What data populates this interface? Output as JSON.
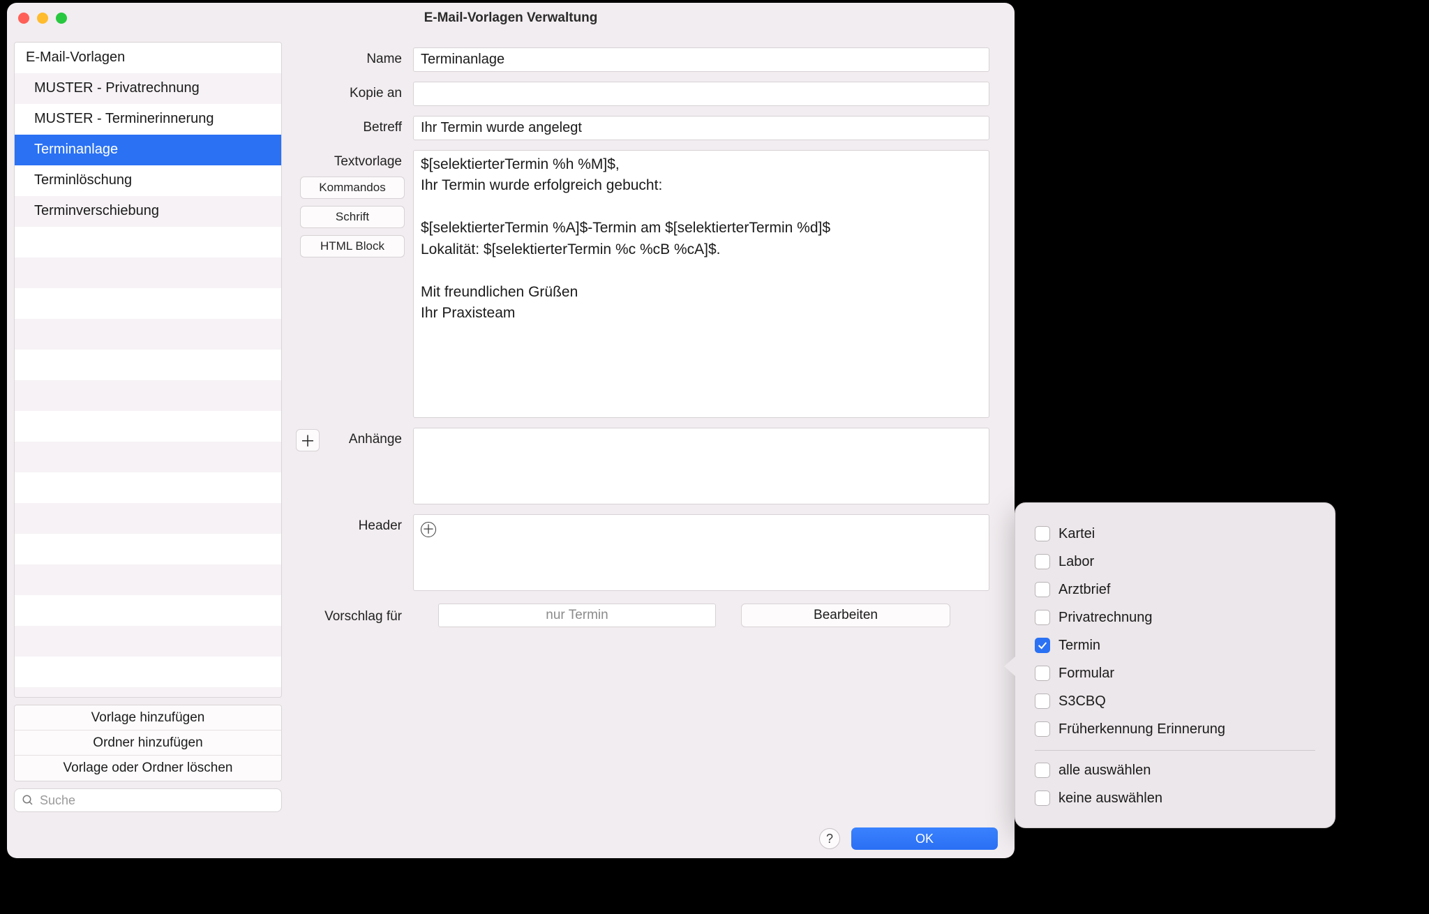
{
  "window": {
    "title": "E-Mail-Vorlagen Verwaltung"
  },
  "sidebar": {
    "header": "E-Mail-Vorlagen",
    "items": [
      {
        "label": "MUSTER - Privatrechnung",
        "selected": false
      },
      {
        "label": "MUSTER - Terminerinnerung",
        "selected": false
      },
      {
        "label": "Terminanlage",
        "selected": true
      },
      {
        "label": "Terminlöschung",
        "selected": false
      },
      {
        "label": "Terminverschiebung",
        "selected": false
      }
    ],
    "actions": {
      "add_template": "Vorlage hinzufügen",
      "add_folder": "Ordner hinzufügen",
      "delete": "Vorlage oder Ordner löschen"
    },
    "search_placeholder": "Suche"
  },
  "form": {
    "labels": {
      "name": "Name",
      "copy": "Kopie an",
      "subject": "Betreff",
      "template": "Textvorlage",
      "attachments": "Anhänge",
      "header": "Header",
      "suggest_for": "Vorschlag für"
    },
    "values": {
      "name": "Terminanlage",
      "copy": "",
      "subject": "Ihr Termin wurde angelegt",
      "template": "$[selektierterTermin %h %M]$,\nIhr Termin wurde erfolgreich gebucht:\n\n$[selektierterTermin %A]$-Termin am $[selektierterTermin %d]$\nLokalität: $[selektierterTermin %c %cB %cA]$.\n\nMit freundlichen Grüßen\nIhr Praxisteam"
    },
    "side_buttons": {
      "commands": "Kommandos",
      "font": "Schrift",
      "html_block": "HTML Block"
    },
    "suggest_value": "nur Termin",
    "edit_button": "Bearbeiten"
  },
  "bottom": {
    "help": "?",
    "ok": "OK"
  },
  "popover": {
    "options": [
      {
        "label": "Kartei",
        "checked": false
      },
      {
        "label": "Labor",
        "checked": false
      },
      {
        "label": "Arztbrief",
        "checked": false
      },
      {
        "label": "Privatrechnung",
        "checked": false
      },
      {
        "label": "Termin",
        "checked": true
      },
      {
        "label": "Formular",
        "checked": false
      },
      {
        "label": "S3CBQ",
        "checked": false
      },
      {
        "label": "Früherkennung Erinnerung",
        "checked": false
      }
    ],
    "select_all": "alle auswählen",
    "select_none": "keine auswählen"
  }
}
